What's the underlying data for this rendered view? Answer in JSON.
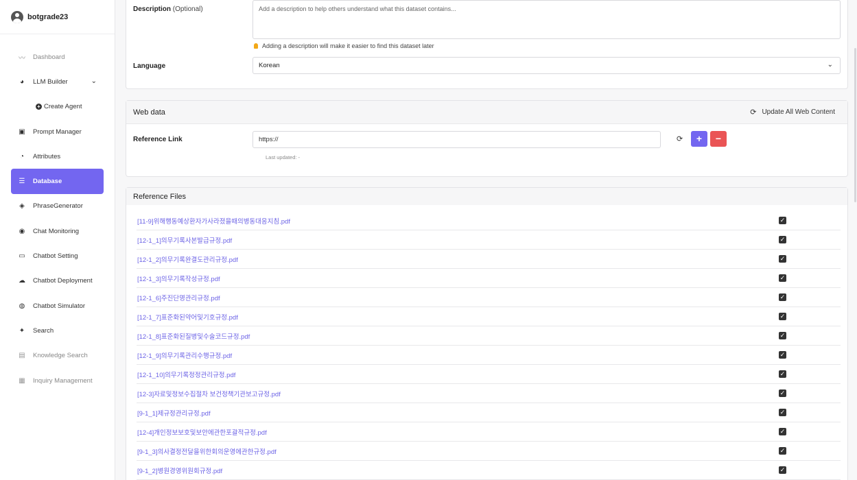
{
  "sidebar": {
    "username": "botgrade23",
    "items": [
      {
        "label": "Dashboard",
        "icon": "chart-line-icon",
        "glyph": "〰",
        "state": "muted"
      },
      {
        "label": "LLM Builder",
        "icon": "brain-icon",
        "glyph": "◕",
        "state": "normal"
      },
      {
        "label": "Create Agent",
        "icon": "plus-circle-icon",
        "state": "sub"
      },
      {
        "label": "Prompt Manager",
        "icon": "terminal-icon",
        "glyph": "▣",
        "state": "normal"
      },
      {
        "label": "Attributes",
        "icon": "gauge-icon",
        "glyph": "◔",
        "state": "normal"
      },
      {
        "label": "Database",
        "icon": "database-icon",
        "glyph": "☰",
        "state": "active"
      },
      {
        "label": "PhraseGenerator",
        "icon": "layers-icon",
        "glyph": "◈",
        "state": "normal"
      },
      {
        "label": "Chat Monitoring",
        "icon": "eye-icon",
        "glyph": "◉",
        "state": "normal"
      },
      {
        "label": "Chatbot Setting",
        "icon": "monitor-icon",
        "glyph": "▭",
        "state": "normal"
      },
      {
        "label": "Chatbot Deployment",
        "icon": "cloud-upload-icon",
        "glyph": "☁",
        "state": "normal"
      },
      {
        "label": "Chatbot Simulator",
        "icon": "chat-bubbles-icon",
        "glyph": "◍",
        "state": "normal"
      },
      {
        "label": "Search",
        "icon": "sparkle-icon",
        "glyph": "✦",
        "state": "normal"
      },
      {
        "label": "Knowledge Search",
        "icon": "knowledge-search-icon",
        "glyph": "▤",
        "state": "muted"
      },
      {
        "label": "Inquiry Management",
        "icon": "inquiry-icon",
        "glyph": "▦",
        "state": "muted"
      }
    ]
  },
  "details": {
    "description_label": "Description",
    "description_optional": "(Optional)",
    "description_placeholder": "Add a description to help others understand what this dataset contains...",
    "description_hint": "Adding a description will make it easier to find this dataset later",
    "language_label": "Language",
    "language_value": "Korean"
  },
  "web_data": {
    "title": "Web data",
    "update_all": "Update All Web Content",
    "reference_link_label": "Reference Link",
    "reference_link_value": "https://",
    "last_updated": "Last updated: -"
  },
  "reference_files": {
    "title": "Reference Files",
    "files": [
      {
        "name": "[11-9]위해행동예상환자가사라졌을때의병동대응지침.pdf",
        "checked": true
      },
      {
        "name": "[12-1_1]의무기록사본발급규정.pdf",
        "checked": true
      },
      {
        "name": "[12-1_2]의무기록완결도관리규정.pdf",
        "checked": true
      },
      {
        "name": "[12-1_3]의무기록작성규정.pdf",
        "checked": true
      },
      {
        "name": "[12-1_6]주진단명관리규정.pdf",
        "checked": true
      },
      {
        "name": "[12-1_7]표준화된약어및기호규정.pdf",
        "checked": true
      },
      {
        "name": "[12-1_8]표준화된질병및수술코드규정.pdf",
        "checked": true
      },
      {
        "name": "[12-1_9]의무기록관리수행규정.pdf",
        "checked": true
      },
      {
        "name": "[12-1_10]의무기록정정관리규정.pdf",
        "checked": true
      },
      {
        "name": "[12-3]자료및정보수집절차 보건정책기관보고규정.pdf",
        "checked": true
      },
      {
        "name": "[9-1_1]제규정관리규정.pdf",
        "checked": true
      },
      {
        "name": "[12-4]개인정보보호및보안에관한포괄적규정.pdf",
        "checked": true
      },
      {
        "name": "[9-1_3]의사결정전달을위한회의운영에관한규정.pdf",
        "checked": true
      },
      {
        "name": "[9-1_2]병원경영위원회규정.pdf",
        "checked": true
      }
    ]
  },
  "colors": {
    "accent": "#7366f0",
    "danger": "#ea5455",
    "link": "#6c63e6"
  }
}
